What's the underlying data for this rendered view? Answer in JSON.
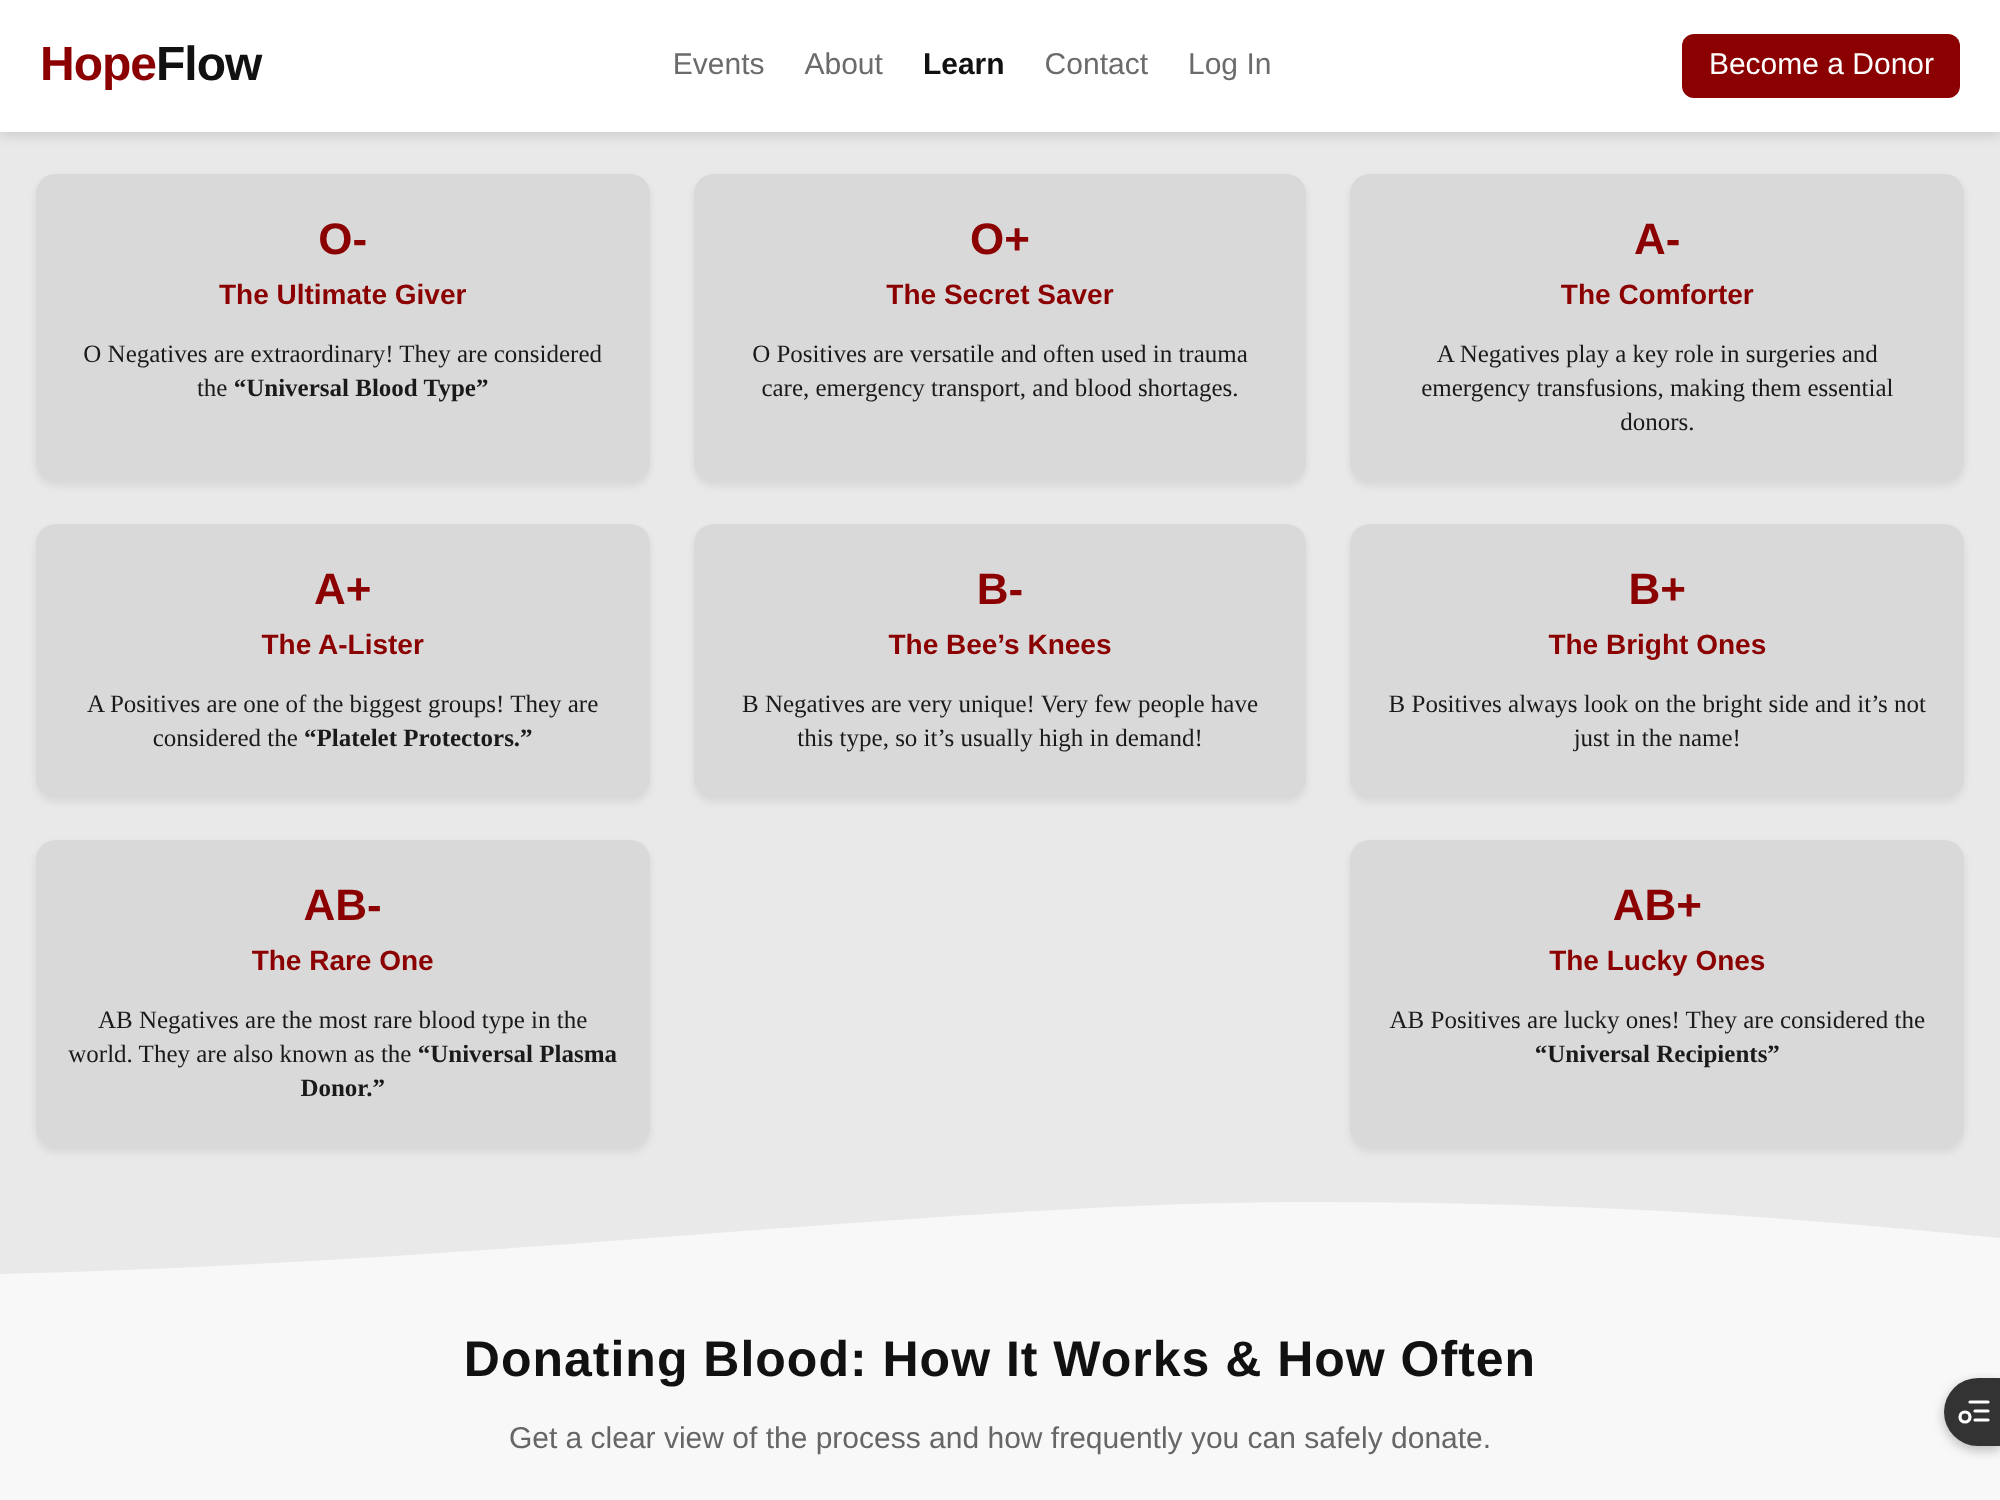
{
  "header": {
    "logo": {
      "first": "Hope",
      "second": "Flow"
    },
    "nav": [
      {
        "label": "Events",
        "selected": false
      },
      {
        "label": "About",
        "selected": false
      },
      {
        "label": "Learn",
        "selected": true
      },
      {
        "label": "Contact",
        "selected": false
      },
      {
        "label": "Log In",
        "selected": false
      }
    ],
    "cta": "Become a Donor"
  },
  "blood_types": [
    {
      "type": "O-",
      "title": "The Ultimate Giver",
      "description": "O Negatives are extraordinary! They are considered the **“Universal Blood Type”**"
    },
    {
      "type": "O+",
      "title": "The Secret Saver",
      "description": "O Positives are versatile and often used in trauma care, emergency transport, and blood shortages."
    },
    {
      "type": "A-",
      "title": "The Comforter",
      "description": "A Negatives play a key role in surgeries and emergency transfusions, making them essential donors."
    },
    {
      "type": "A+",
      "title": "The A-Lister",
      "description": "A Positives are one of the biggest groups! They are considered the **“Platelet Protectors.”**"
    },
    {
      "type": "B-",
      "title": "The Bee’s Knees",
      "description": "B Negatives are very unique! Very few people have this type, so it’s usually high in demand!"
    },
    {
      "type": "B+",
      "title": "The Bright Ones",
      "description": "B Positives always look on the bright side and it’s not just in the name!"
    },
    {
      "type": "AB-",
      "title": "The Rare One",
      "description": "AB Negatives are the most rare blood type in the world. They are also known as the **“Universal Plasma Donor.”**"
    },
    {
      "type": "AB+",
      "title": "The Lucky Ones",
      "description": "AB Positives are lucky ones! They are considered the **“Universal Recipients”**"
    }
  ],
  "section": {
    "title": "Donating Blood: How It Works & How Often",
    "subtitle": "Get a clear view of the process and how frequently you can safely donate."
  }
}
